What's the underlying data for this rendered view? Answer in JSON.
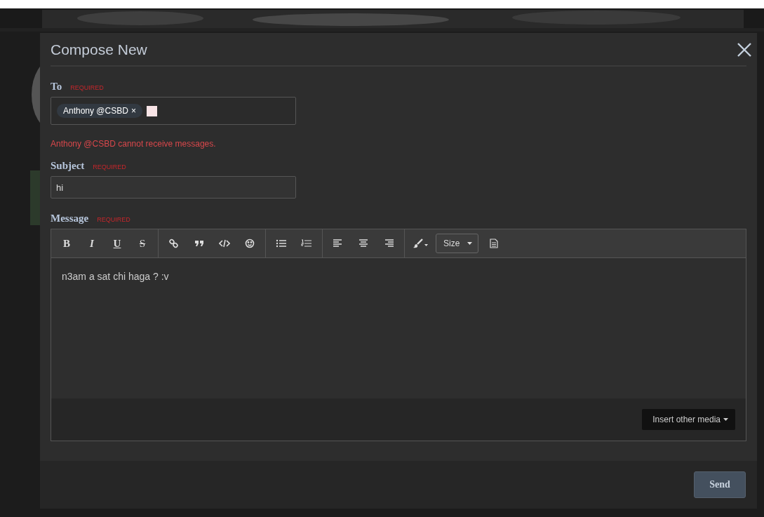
{
  "dialog": {
    "title": "Compose New",
    "to": {
      "label": "To",
      "required": "REQUIRED",
      "tokens": [
        {
          "name": "Anthony @CSBD",
          "remove": "×"
        }
      ],
      "error": "Anthony @CSBD cannot receive messages."
    },
    "subject": {
      "label": "Subject",
      "required": "REQUIRED",
      "value": "hi"
    },
    "message": {
      "label": "Message",
      "required": "REQUIRED",
      "toolbar": [
        {
          "items": [
            {
              "kind": "bold",
              "text": "B"
            },
            {
              "kind": "italic",
              "text": "I"
            },
            {
              "kind": "underline",
              "text": "U"
            },
            {
              "kind": "strike",
              "text": "S"
            }
          ]
        },
        {
          "items": [
            {
              "kind": "link"
            },
            {
              "kind": "quote"
            },
            {
              "kind": "code"
            },
            {
              "kind": "emoji"
            }
          ]
        },
        {
          "items": [
            {
              "kind": "bullets"
            },
            {
              "kind": "numbers"
            }
          ]
        },
        {
          "items": [
            {
              "kind": "align-left"
            },
            {
              "kind": "align-center"
            },
            {
              "kind": "align-right"
            }
          ]
        },
        {
          "items": [
            {
              "kind": "color"
            },
            {
              "kind": "size",
              "text": "Size"
            },
            {
              "kind": "source"
            }
          ]
        }
      ],
      "body": "n3am a sat chi haga ? :v",
      "insert_media": "Insert other media"
    },
    "send": "Send"
  }
}
